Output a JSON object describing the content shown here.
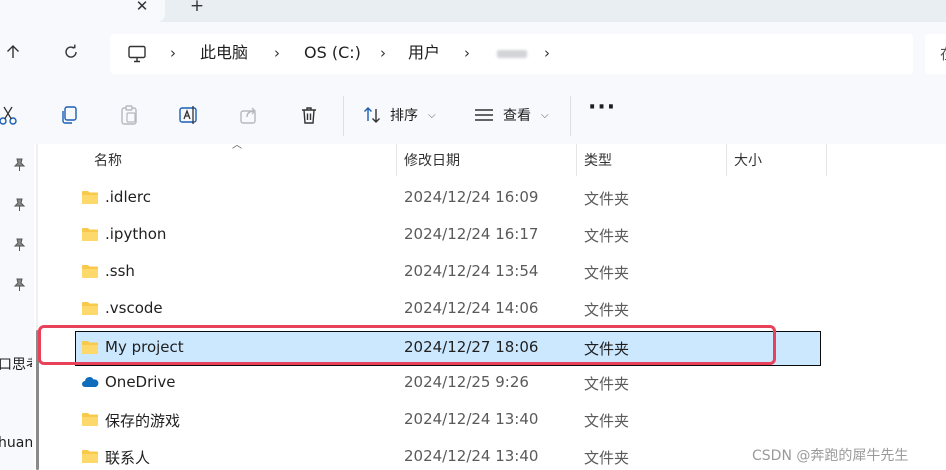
{
  "tabs": {
    "close_glyph": "✕",
    "new_tab_glyph": "+"
  },
  "breadcrumb": {
    "items": [
      "此电脑",
      "OS (C:)",
      "用户"
    ],
    "separator": "›"
  },
  "search": {
    "placeholder_fragment": "在"
  },
  "toolbar": {
    "sort_label": "排序",
    "view_label": "查看",
    "more_label": "···"
  },
  "nav_pane": {
    "fragments": [
      "口思考",
      "huan"
    ]
  },
  "columns": {
    "name": "名称",
    "date": "修改日期",
    "type": "类型",
    "size": "大小"
  },
  "files": [
    {
      "name": ".idlerc",
      "date": "2024/12/24 16:09",
      "type": "文件夹",
      "icon": "folder-icon"
    },
    {
      "name": ".ipython",
      "date": "2024/12/24 16:17",
      "type": "文件夹",
      "icon": "folder-icon"
    },
    {
      "name": ".ssh",
      "date": "2024/12/24 13:54",
      "type": "文件夹",
      "icon": "folder-icon"
    },
    {
      "name": ".vscode",
      "date": "2024/12/24 14:06",
      "type": "文件夹",
      "icon": "folder-icon"
    },
    {
      "name": "My project",
      "date": "2024/12/27 18:06",
      "type": "文件夹",
      "icon": "folder-icon",
      "selected": true
    },
    {
      "name": "OneDrive",
      "date": "2024/12/25 9:26",
      "type": "文件夹",
      "icon": "onedrive-cloud-icon"
    },
    {
      "name": "保存的游戏",
      "date": "2024/12/24 13:40",
      "type": "文件夹",
      "icon": "folder-icon"
    },
    {
      "name": "联系人",
      "date": "2024/12/24 13:40",
      "type": "文件夹",
      "icon": "folder-icon"
    }
  ],
  "colors": {
    "selection_fill": "#cce8ff",
    "highlight_border": "#e8425a",
    "folder_yellow": "#f8c94a",
    "onedrive_blue": "#0f6cbd"
  },
  "watermark": "CSDN @奔跑的犀牛先生"
}
